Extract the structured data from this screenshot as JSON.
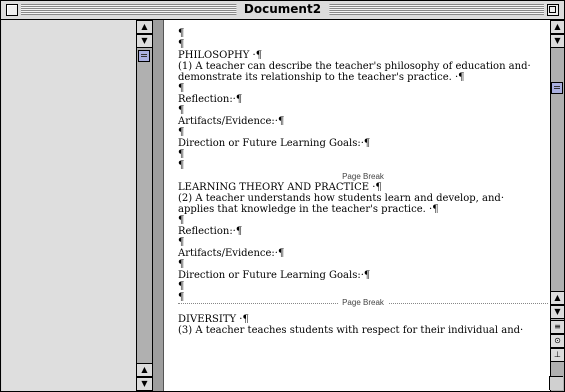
{
  "window": {
    "title": "Document2"
  },
  "scrollbars": {
    "left_up": "▲",
    "left_down": "▼",
    "left_end_up": "▲",
    "left_end_down": "▼",
    "right_up": "▲",
    "right_down": "▼",
    "right_end_up": "▲",
    "right_end_down": "▼",
    "view_buttons": [
      "≡",
      "⊙",
      "⊥"
    ]
  },
  "document": {
    "pilcrow": "¶",
    "lines_top": [
      "¶",
      "¶",
      "PHILOSOPHY ·¶",
      "(1) A teacher can describe the teacher's philosophy of education and·",
      "demonstrate its relationship to the teacher's practice. ·¶",
      "¶",
      "Reflection:·¶",
      "¶",
      "Artifacts/Evidence:·¶",
      "¶",
      "Direction or Future Learning Goals:·¶",
      "¶",
      "¶"
    ],
    "page_break_1": "Page Break",
    "lines_mid": [
      "LEARNING THEORY AND PRACTICE ·¶",
      "(2) A teacher understands how students learn and develop, and·",
      "applies that knowledge in the teacher's practice. ·¶",
      "¶",
      "Reflection:·¶",
      "¶",
      "Artifacts/Evidence:·¶",
      "¶",
      "Direction or Future Learning Goals:·¶",
      "¶",
      "¶"
    ],
    "page_break_2": "Page Break",
    "lines_bottom": [
      "DIVERSITY ·¶",
      "(3) A teacher teaches students with respect for their individual and·"
    ]
  }
}
